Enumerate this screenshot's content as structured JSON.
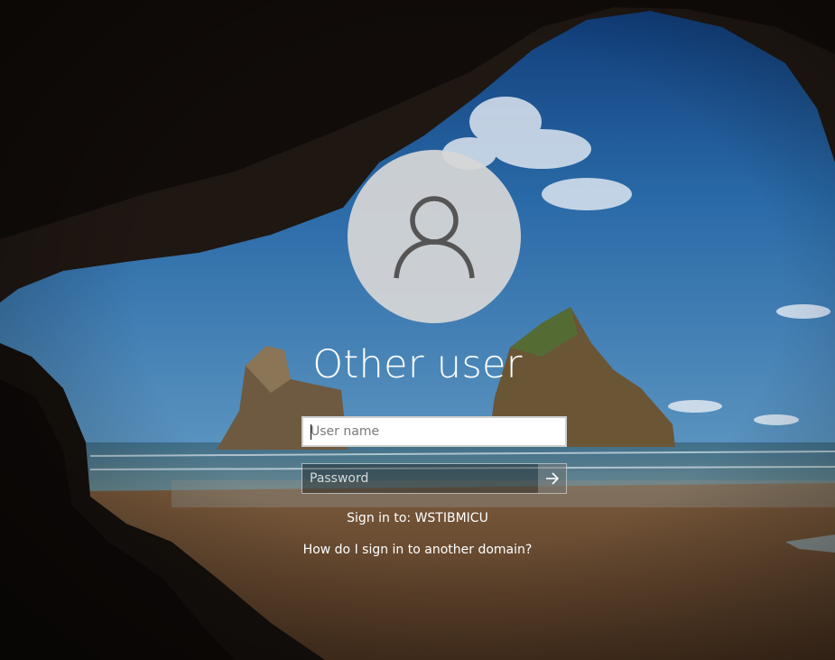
{
  "login": {
    "title": "Other user",
    "username_placeholder": "User name",
    "password_placeholder": "Password",
    "sign_in_to": "Sign in to: WSTIBMICU",
    "help_link": "How do I sign in to another domain?"
  },
  "icons": {
    "avatar": "user-icon",
    "submit": "arrow-right-icon"
  },
  "colors": {
    "text": "#ffffff",
    "avatar_bg": "#d6d6d6",
    "icon": "#555555"
  }
}
